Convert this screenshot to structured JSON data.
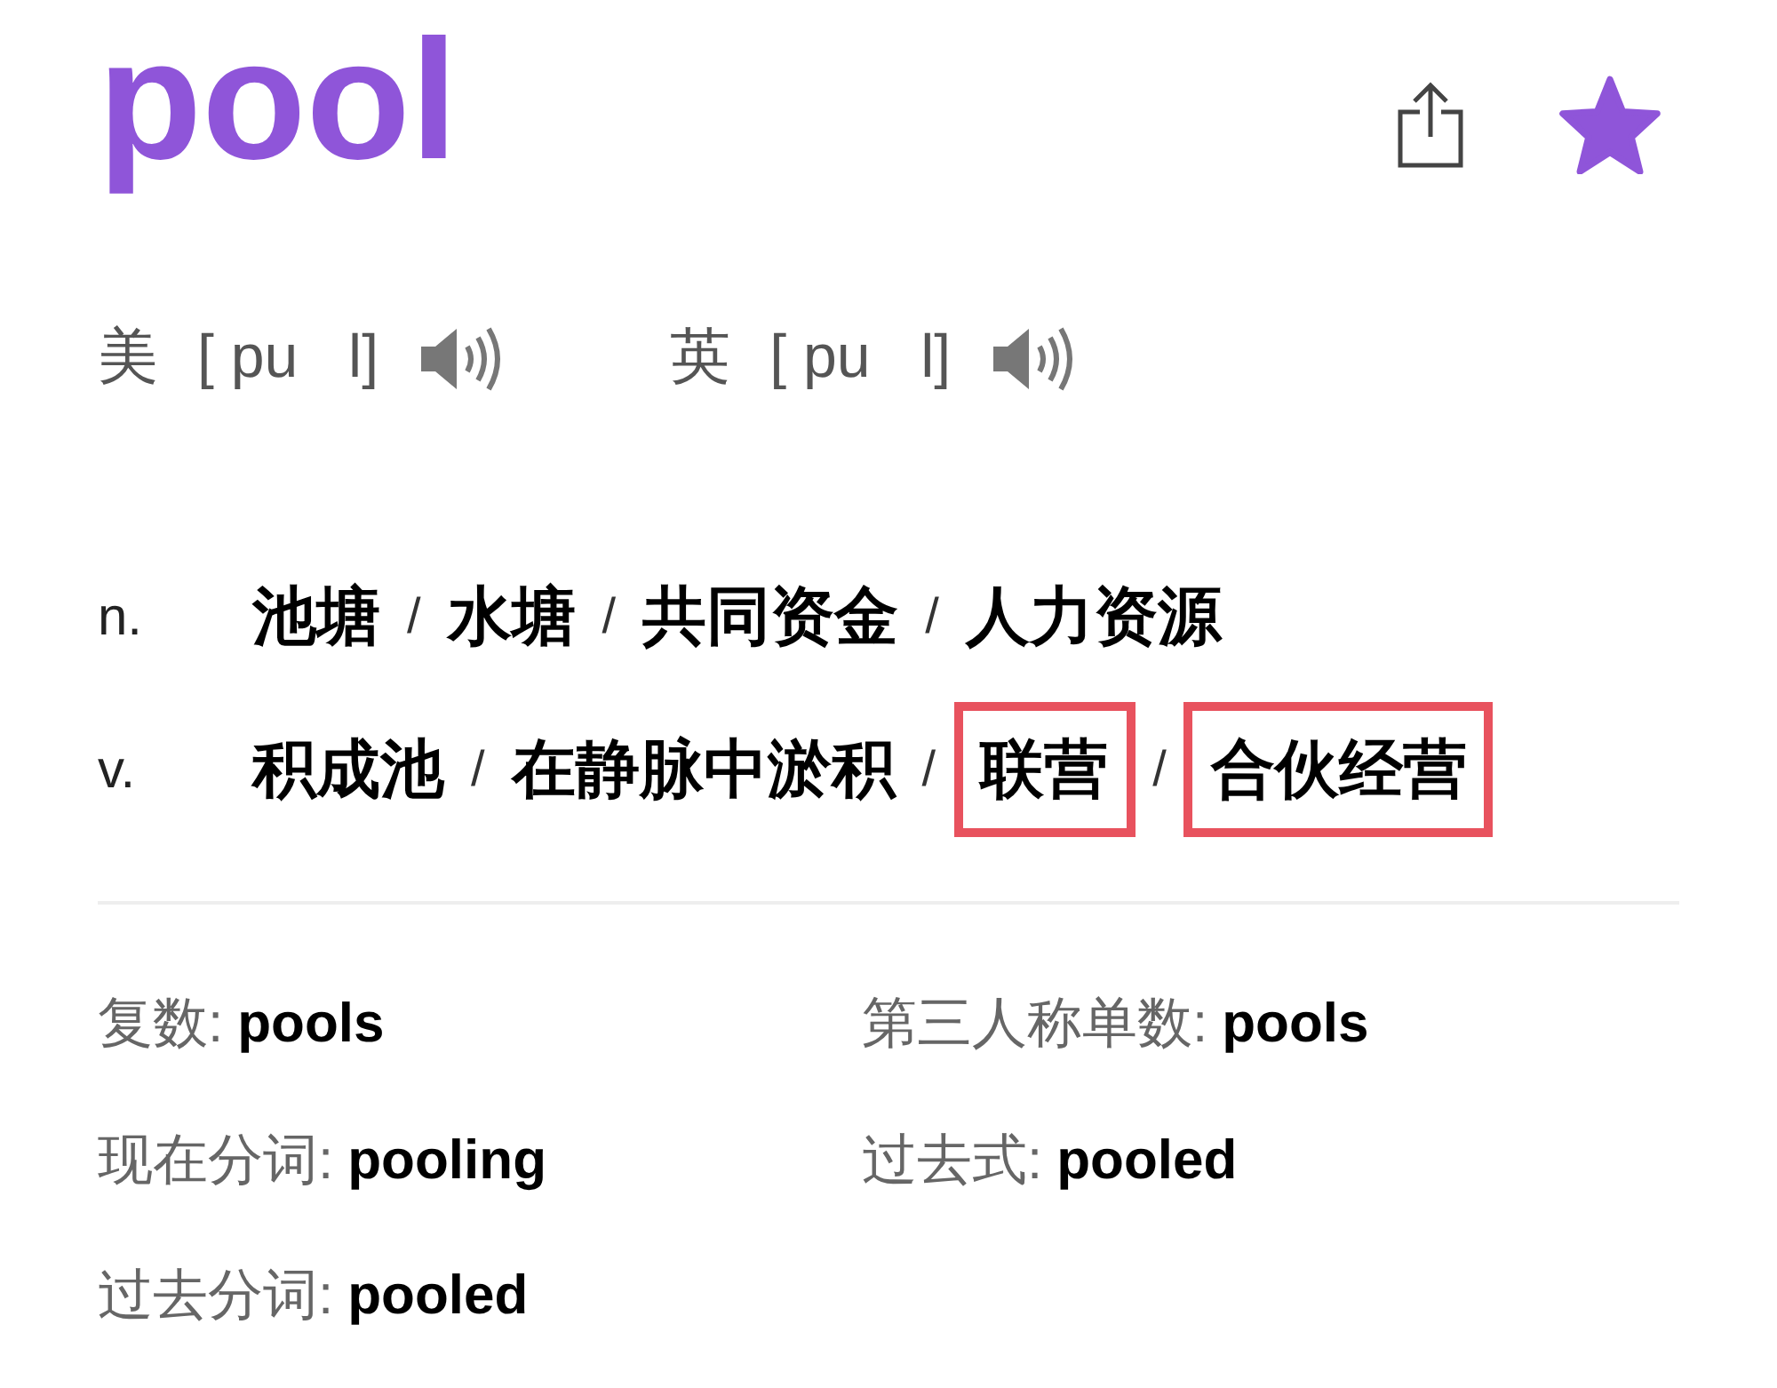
{
  "headword": "pool",
  "favorite": true,
  "pronunciations": [
    {
      "region": "美",
      "phonetic": "[ pu   l]"
    },
    {
      "region": "英",
      "phonetic": "[ pu   l]"
    }
  ],
  "senses": [
    {
      "pos": "n.",
      "items": [
        {
          "kind": "meaning",
          "text": "池塘",
          "highlighted": false
        },
        {
          "kind": "separator",
          "text": "/"
        },
        {
          "kind": "meaning",
          "text": "水塘",
          "highlighted": false
        },
        {
          "kind": "separator",
          "text": "/"
        },
        {
          "kind": "meaning",
          "text": "共同资金",
          "highlighted": false
        },
        {
          "kind": "separator",
          "text": "/"
        },
        {
          "kind": "meaning",
          "text": "人力资源",
          "highlighted": false
        }
      ]
    },
    {
      "pos": "v.",
      "items": [
        {
          "kind": "meaning",
          "text": "积成池",
          "highlighted": false
        },
        {
          "kind": "separator",
          "text": "/"
        },
        {
          "kind": "meaning",
          "text": "在静脉中淤积",
          "highlighted": false
        },
        {
          "kind": "separator",
          "text": "/"
        },
        {
          "kind": "meaning",
          "text": "联营",
          "highlighted": true
        },
        {
          "kind": "separator",
          "text": "/"
        },
        {
          "kind": "meaning",
          "text": "合伙经营",
          "highlighted": true
        }
      ]
    }
  ],
  "forms": [
    {
      "label": "复数:",
      "value": "pools"
    },
    {
      "label": "第三人称单数:",
      "value": "pools"
    },
    {
      "label": "现在分词:",
      "value": "pooling"
    },
    {
      "label": "过去式:",
      "value": "pooled"
    },
    {
      "label": "过去分词:",
      "value": "pooled"
    }
  ]
}
